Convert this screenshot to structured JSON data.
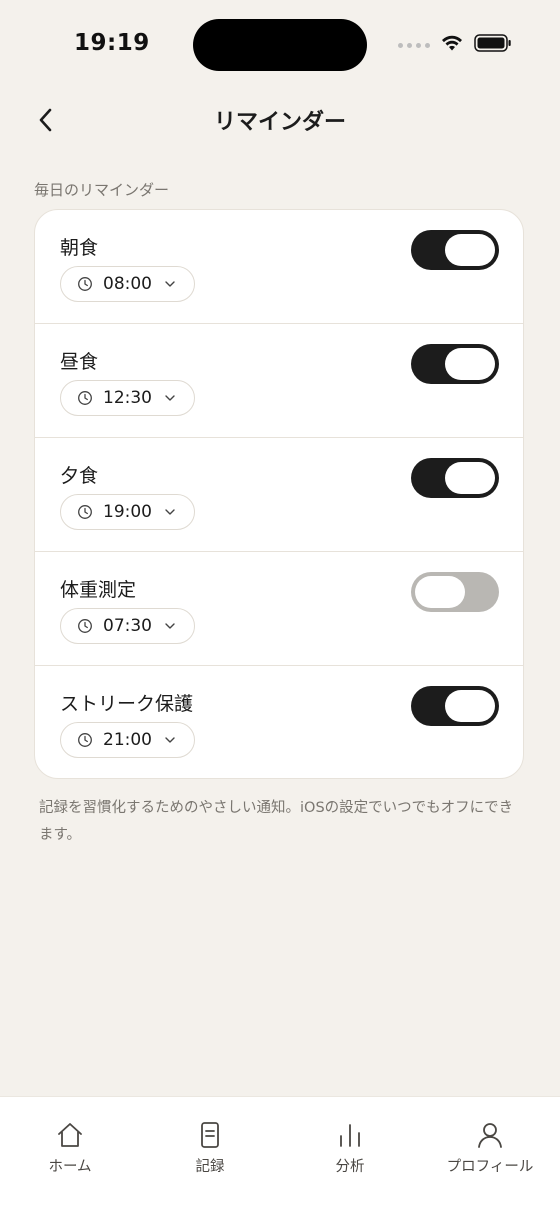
{
  "status_bar": {
    "time": "19:19"
  },
  "nav": {
    "title": "リマインダー"
  },
  "section_label": "毎日のリマインダー",
  "reminders": [
    {
      "title": "朝食",
      "time": "08:00",
      "enabled": true
    },
    {
      "title": "昼食",
      "time": "12:30",
      "enabled": true
    },
    {
      "title": "夕食",
      "time": "19:00",
      "enabled": true
    },
    {
      "title": "体重測定",
      "time": "07:30",
      "enabled": false
    },
    {
      "title": "ストリーク保護",
      "time": "21:00",
      "enabled": true
    }
  ],
  "footnote": "記録を習慣化するためのやさしい通知。iOSの設定でいつでもオフにできます。",
  "tabs": [
    {
      "label": "ホーム",
      "icon": "home-icon"
    },
    {
      "label": "記録",
      "icon": "document-icon"
    },
    {
      "label": "分析",
      "icon": "bar-chart-icon"
    },
    {
      "label": "プロフィール",
      "icon": "person-icon"
    }
  ],
  "colors": {
    "background": "#f4f1ec",
    "toggle_on": "#1c1c1c",
    "toggle_off": "#b9b7b3"
  }
}
